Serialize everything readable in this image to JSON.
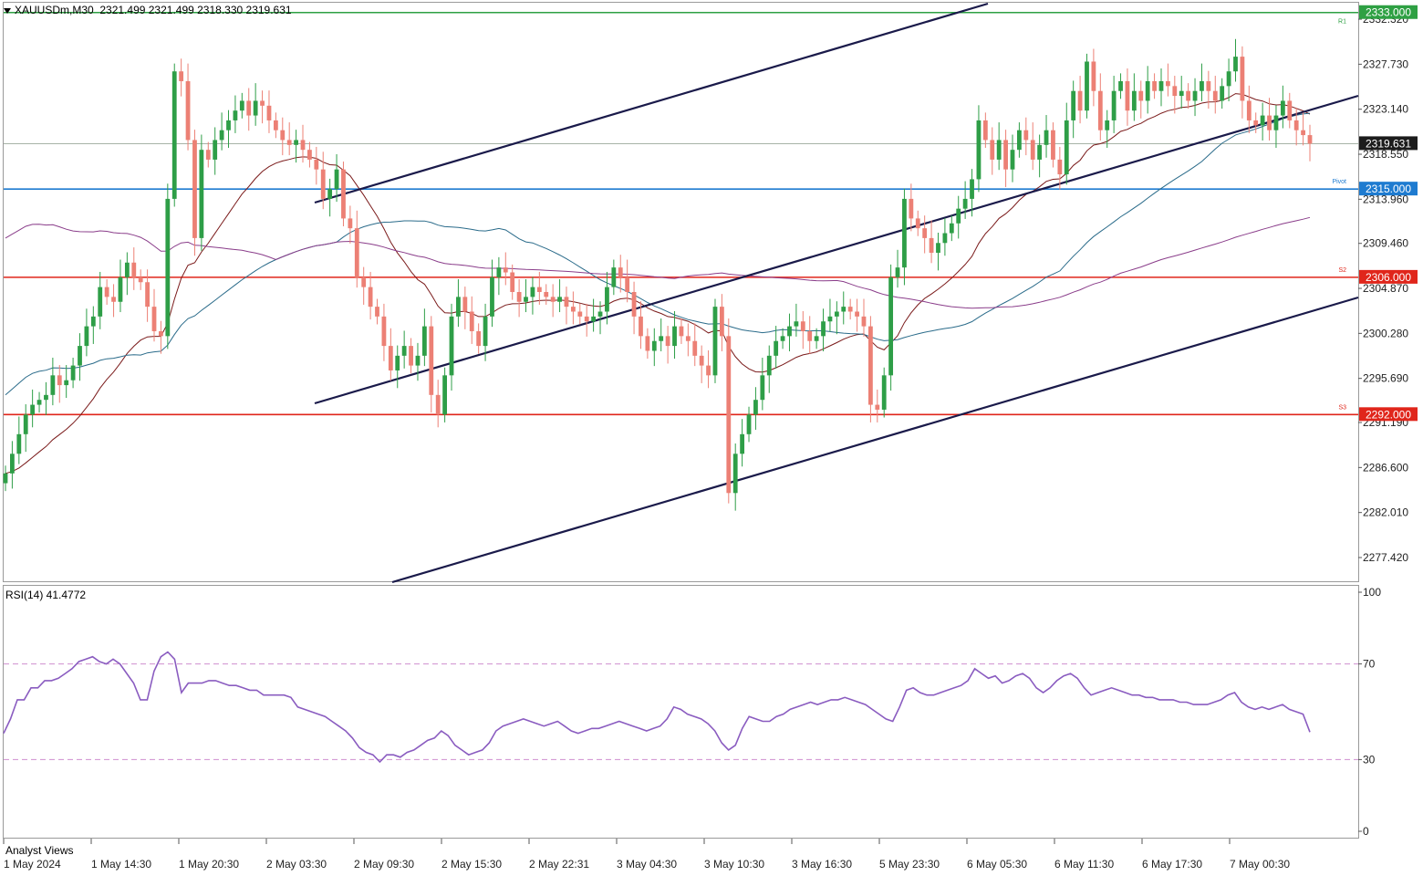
{
  "header": {
    "symbol": "XAUUSDm,M30",
    "ohlc": "2321.499 2321.499 2318.330 2319.631"
  },
  "rsi_panel": {
    "label": "RSI(14) 41.4772"
  },
  "footer_label": "Analyst Views",
  "colors": {
    "bull": "#2e9e47",
    "bear": "#ec8075",
    "ma_dark": "#7a1a1a",
    "ma_teal": "#2a6b8a",
    "ma_purple": "#8a3d8a",
    "pivot": "#1e7bd0",
    "support": "#e0261b",
    "r1": "#2ea043",
    "channel": "#1a1a4a",
    "rsi": "#8a5cc0",
    "rsi_level": "#cf8fcf"
  },
  "chart_data": [
    {
      "type": "candlestick",
      "symbol": "XAUUSDm",
      "timeframe": "M30",
      "ylim": [
        2275.0,
        2334.0
      ],
      "y_ticks": [
        "2332.320",
        "2327.730",
        "2323.140",
        "2318.550",
        "2313.960",
        "2309.460",
        "2304.870",
        "2300.280",
        "2295.690",
        "2291.190",
        "2286.600",
        "2282.010",
        "2277.420"
      ],
      "x_ticks": [
        "1 May 2024",
        "1 May 14:30",
        "1 May 20:30",
        "2 May 03:30",
        "2 May 09:30",
        "2 May 15:30",
        "2 May 22:31",
        "3 May 04:30",
        "3 May 10:30",
        "3 May 16:30",
        "5 May 23:30",
        "6 May 05:30",
        "6 May 11:30",
        "6 May 17:30",
        "7 May 00:30"
      ],
      "current_price": "2319.631",
      "levels": [
        {
          "price": "2333.000",
          "code": "R1",
          "color": "#2ea043"
        },
        {
          "price": "2315.000",
          "code": "Pivot",
          "color": "#1e7bd0"
        },
        {
          "price": "2306.000",
          "code": "S2",
          "color": "#e0261b"
        },
        {
          "price": "2292.000",
          "code": "S3",
          "color": "#e0261b"
        }
      ],
      "closes": [
        2286.0,
        2288.0,
        2290.0,
        2292.0,
        2293.0,
        2293.5,
        2294.0,
        2296.0,
        2295.0,
        2295.5,
        2297.0,
        2299.0,
        2301.0,
        2302.0,
        2305.0,
        2304.0,
        2303.5,
        2306.0,
        2307.5,
        2306.0,
        2305.5,
        2303.0,
        2300.5,
        2300.0,
        2314.0,
        2327.0,
        2326.0,
        2320.0,
        2310.0,
        2319.0,
        2318.0,
        2320.0,
        2321.0,
        2322.0,
        2323.0,
        2324.0,
        2322.5,
        2324.0,
        2323.5,
        2322.0,
        2321.0,
        2320.0,
        2319.5,
        2320.0,
        2319.0,
        2318.0,
        2317.0,
        2314.0,
        2315.0,
        2317.0,
        2312.0,
        2311.0,
        2306.0,
        2305.0,
        2303.0,
        2302.0,
        2299.0,
        2296.5,
        2298.0,
        2299.0,
        2297.0,
        2298.0,
        2301.0,
        2294.0,
        2292.0,
        2296.0,
        2302.0,
        2304.0,
        2302.5,
        2300.5,
        2299.0,
        2302.0,
        2306.0,
        2307.0,
        2306.5,
        2304.5,
        2303.5,
        2304.0,
        2305.0,
        2304.5,
        2304.0,
        2303.5,
        2304.0,
        2303.0,
        2302.5,
        2302.0,
        2301.5,
        2302.0,
        2302.5,
        2305.0,
        2307.0,
        2306.0,
        2304.5,
        2302.0,
        2300.0,
        2298.5,
        2299.5,
        2300.0,
        2299.0,
        2301.0,
        2300.0,
        2299.5,
        2298.0,
        2297.0,
        2296.0,
        2303.0,
        2300.0,
        2284.0,
        2288.0,
        2290.0,
        2292.0,
        2293.5,
        2296.0,
        2298.0,
        2299.5,
        2300.0,
        2301.0,
        2301.5,
        2300.5,
        2299.5,
        2300.0,
        2301.5,
        2302.0,
        2302.5,
        2303.0,
        2302.5,
        2302.0,
        2301.0,
        2293.0,
        2292.5,
        2296.0,
        2306.0,
        2307.0,
        2314.0,
        2312.0,
        2311.0,
        2310.0,
        2308.5,
        2309.5,
        2310.5,
        2311.5,
        2313.0,
        2314.0,
        2316.0,
        2322.0,
        2320.0,
        2318.0,
        2320.0,
        2317.0,
        2319.0,
        2321.0,
        2320.0,
        2318.0,
        2319.5,
        2321.0,
        2318.0,
        2316.5,
        2322.0,
        2325.0,
        2323.0,
        2328.0,
        2325.0,
        2321.0,
        2322.0,
        2325.0,
        2326.0,
        2323.0,
        2325.0,
        2324.0,
        2326.0,
        2325.0,
        2326.0,
        2325.5,
        2324.5,
        2325.0,
        2324.0,
        2325.0,
        2326.0,
        2325.0,
        2324.0,
        2325.5,
        2327.0,
        2328.5,
        2324.0,
        2322.0,
        2321.5,
        2322.5,
        2321.0,
        2322.5,
        2324.0,
        2322.0,
        2321.0,
        2320.5,
        2319.631
      ]
    },
    {
      "type": "line",
      "name": "RSI(14)",
      "ylim": [
        0,
        100
      ],
      "y_ticks": [
        "100",
        "70",
        "30",
        "0"
      ],
      "levels": [
        70,
        30
      ],
      "values": [
        41,
        47,
        55,
        55,
        60,
        60,
        63,
        63,
        64,
        66,
        68,
        71,
        72,
        73,
        71,
        70,
        72,
        70,
        66,
        62,
        55,
        55,
        67,
        73,
        75,
        72,
        58,
        62,
        62,
        62,
        63,
        63,
        62,
        61,
        61,
        60,
        59,
        59,
        57,
        57,
        57,
        57,
        56,
        52,
        51,
        50,
        49,
        48,
        46,
        44,
        42,
        39,
        35,
        33,
        32,
        29,
        32,
        32,
        31,
        33,
        34,
        36,
        38,
        39,
        42,
        40,
        36,
        34,
        32,
        33,
        34,
        37,
        42,
        44,
        45,
        46,
        47,
        46,
        45,
        44,
        45,
        46,
        44,
        42,
        41,
        42,
        43,
        43,
        44,
        45,
        46,
        45,
        44,
        43,
        42,
        43,
        44,
        47,
        52,
        51,
        49,
        48,
        47,
        45,
        42,
        37,
        34,
        36,
        43,
        48,
        47,
        46,
        46,
        48,
        49,
        51,
        52,
        53,
        54,
        53,
        54,
        55,
        55,
        56,
        55,
        54,
        53,
        51,
        49,
        47,
        46,
        52,
        59,
        60,
        58,
        57,
        57,
        58,
        59,
        60,
        61,
        63,
        68,
        66,
        64,
        65,
        62,
        63,
        65,
        66,
        64,
        60,
        58,
        60,
        63,
        65,
        66,
        64,
        60,
        57,
        58,
        59,
        60,
        59,
        58,
        57,
        57,
        56,
        56,
        55,
        55,
        55,
        54,
        54,
        53,
        53,
        53,
        54,
        55,
        57,
        58,
        54,
        52,
        51,
        52,
        51,
        52,
        53,
        51,
        50,
        49,
        41.4772
      ]
    }
  ]
}
